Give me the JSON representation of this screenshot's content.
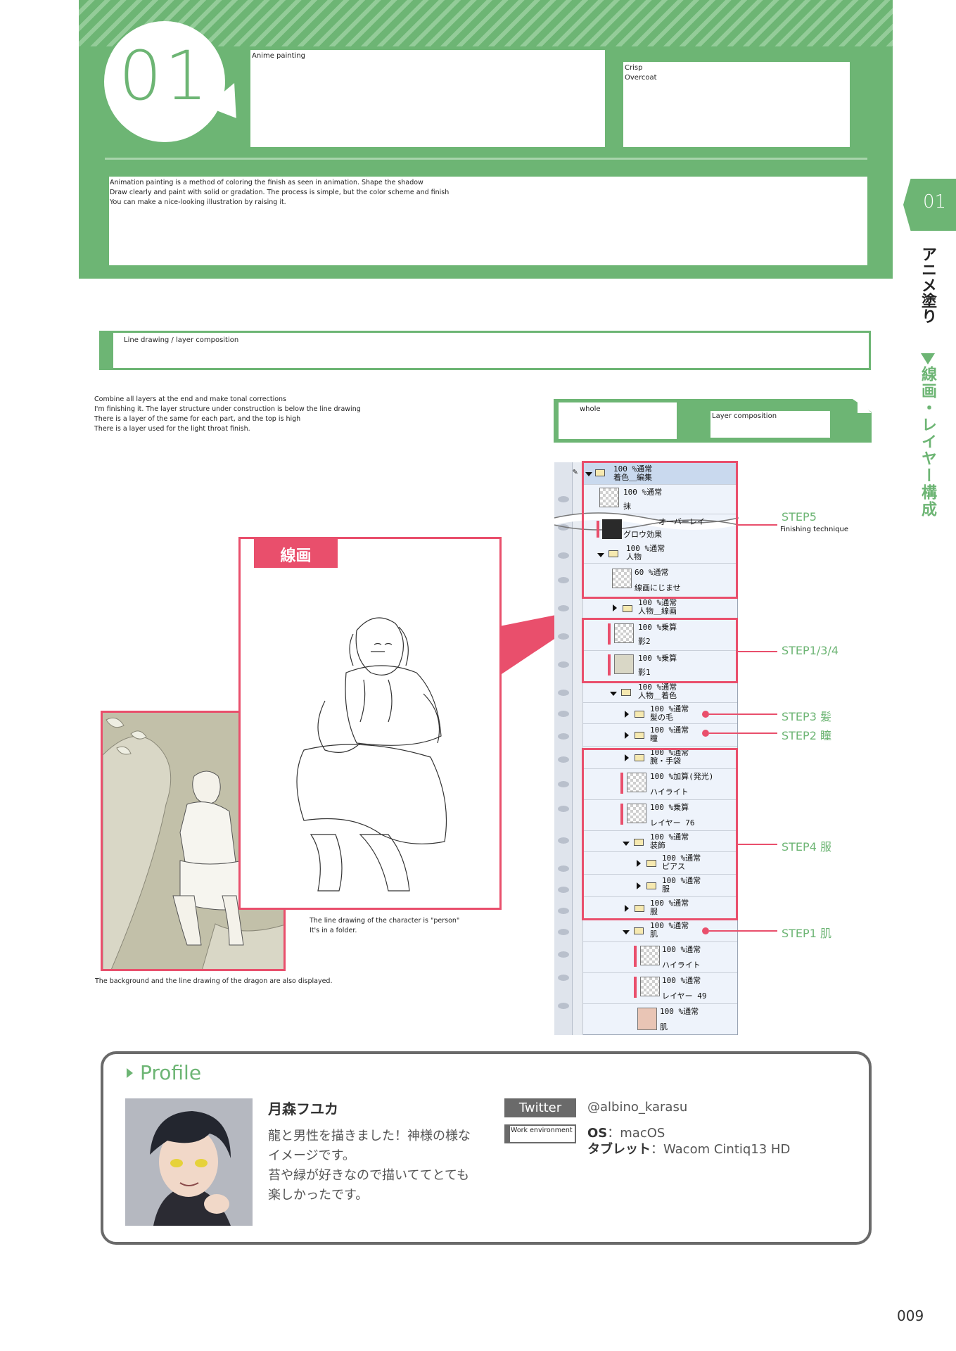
{
  "header": {
    "chapter_number": "01",
    "title_box": "Anime painting",
    "sub_box_line1": "Crisp",
    "sub_box_line2": "Overcoat",
    "description": [
      "Animation painting is a method of coloring the finish as seen in animation. Shape the shadow",
      "Draw clearly and paint with solid or gradation. The process is simple, but the color scheme and finish",
      "You can make a nice-looking illustration by raising it."
    ]
  },
  "side_tab": {
    "number": "01",
    "label1": "アニメ塗り",
    "label2": "線画・レイヤー構成"
  },
  "section": {
    "title": "Line drawing / layer composition"
  },
  "body_text": [
    "Combine all layers at the end and make tonal corrections",
    "I'm finishing it. The layer structure under construction is below the line drawing",
    "There is a layer of the same for each part, and the top is high",
    "There is a layer used for the light throat finish."
  ],
  "layer_comp": {
    "left_label": "whole",
    "right_label": "Layer composition"
  },
  "line_drawing": {
    "label": "線画",
    "caption": [
      "The line drawing of the character is \"person\"",
      "It's in a folder."
    ]
  },
  "color_caption": "The background and the line drawing of the dragon are also displayed.",
  "layers": [
    {
      "mode": "100 %通常",
      "name": "着色＿編集"
    },
    {
      "mode": "100 %通常",
      "name": "抹"
    },
    {
      "mode": "オーバーレイ",
      "name": "グロウ効果"
    },
    {
      "mode": "100 %通常",
      "name": "人物"
    },
    {
      "mode": "60 %通常",
      "name": "線画にじませ"
    },
    {
      "mode": "100 %通常",
      "name": "人物＿線画"
    },
    {
      "mode": "100 %乗算",
      "name": "影2"
    },
    {
      "mode": "100 %乗算",
      "name": "影1"
    },
    {
      "mode": "100 %通常",
      "name": "人物＿着色"
    },
    {
      "mode": "100 %通常",
      "name": "髪の毛"
    },
    {
      "mode": "100 %通常",
      "name": "瞳"
    },
    {
      "mode": "100 %通常",
      "name": "腕・手袋"
    },
    {
      "mode": "100 %加算(発光)",
      "name": "ハイライト"
    },
    {
      "mode": "100 %乗算",
      "name": "レイヤー 76"
    },
    {
      "mode": "100 %通常",
      "name": "装飾"
    },
    {
      "mode": "100 %通常",
      "name": "ピアス"
    },
    {
      "mode": "100 %通常",
      "name": "服"
    },
    {
      "mode": "100 %通常",
      "name": "服"
    },
    {
      "mode": "100 %通常",
      "name": "肌"
    },
    {
      "mode": "100 %通常",
      "name": "ハイライト"
    },
    {
      "mode": "100 %通常",
      "name": "レイヤー 49"
    },
    {
      "mode": "100 %通常",
      "name": "肌"
    }
  ],
  "steps": {
    "step5": "STEP5",
    "step5_sub": "Finishing technique",
    "step134": "STEP1/3/4",
    "step3": "STEP3 髪",
    "step2": "STEP2 瞳",
    "step4": "STEP4 服",
    "step1": "STEP1 肌"
  },
  "profile": {
    "title": "Profile",
    "name": "月森フユカ",
    "text": [
      "龍と男性を描きました！神様の様な",
      "イメージです。",
      "苔や緑が好きなので描いててとても",
      "楽しかったです。"
    ],
    "twitter_label": "Twitter",
    "twitter_handle": "@albino_karasu",
    "work_env_label": "Work environment",
    "os_key": "OS",
    "os_value": "：macOS",
    "tablet_key": "タブレット",
    "tablet_value": "：Wacom Cintiq13 HD"
  },
  "page_number": "009",
  "colors": {
    "green": "#6db574",
    "pink": "#e94f6c",
    "gray": "#6a6a6a"
  }
}
